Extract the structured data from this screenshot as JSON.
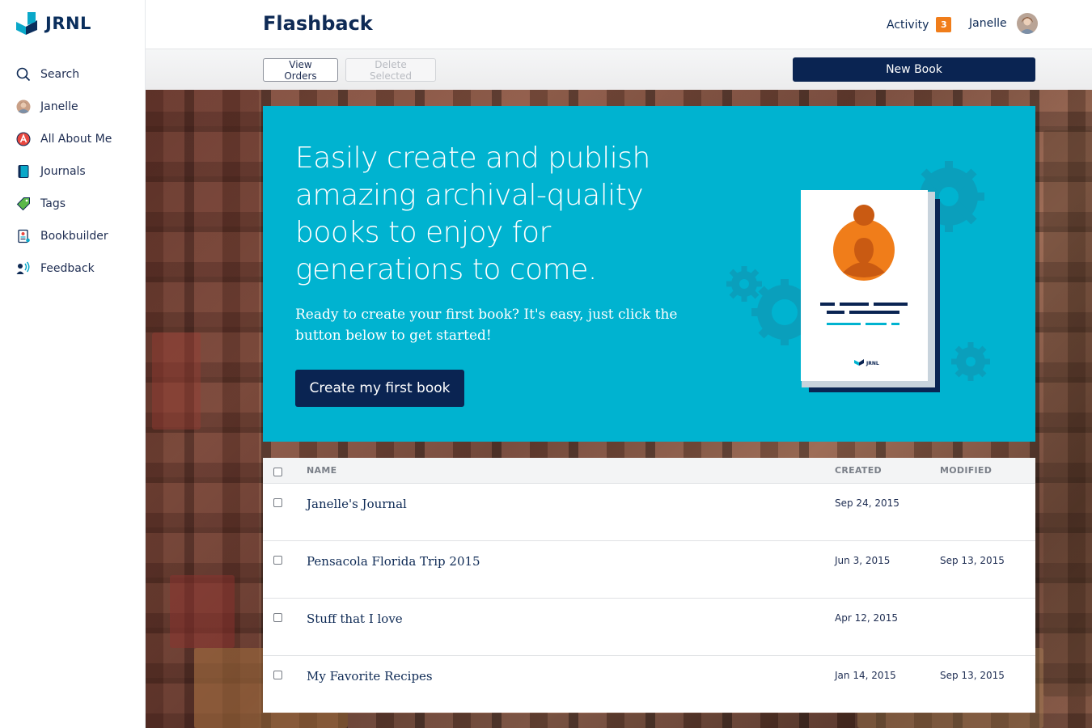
{
  "brand": {
    "logo_text": "JRNL"
  },
  "sidebar": {
    "items": [
      {
        "label": "Search",
        "icon": "search-icon"
      },
      {
        "label": "Janelle",
        "icon": "user-avatar-icon"
      },
      {
        "label": "All About Me",
        "icon": "all-about-me-icon"
      },
      {
        "label": "Journals",
        "icon": "journal-icon"
      },
      {
        "label": "Tags",
        "icon": "tag-icon"
      },
      {
        "label": "Bookbuilder",
        "icon": "bookbuilder-icon"
      },
      {
        "label": "Feedback",
        "icon": "feedback-icon"
      }
    ]
  },
  "header": {
    "title": "Flashback",
    "activity_label": "Activity",
    "activity_count": "3",
    "user_name": "Janelle"
  },
  "toolbar": {
    "view_orders_label": "View Orders",
    "delete_selected_label": "Delete Selected",
    "new_book_label": "New Book"
  },
  "promo": {
    "headline": "Easily create and publish amazing archival-quality books to enjoy for generations to come.",
    "subtext": "Ready to create your first book? It's easy, just click the button below to get started!",
    "cta_label": "Create my first book",
    "book_logo_text": "JRNL"
  },
  "table": {
    "columns": {
      "name": "NAME",
      "created": "CREATED",
      "modified": "MODIFIED"
    },
    "rows": [
      {
        "name": "Janelle's Journal",
        "created": "Sep 24, 2015",
        "modified": ""
      },
      {
        "name": "Pensacola Florida Trip 2015",
        "created": "Jun 3, 2015",
        "modified": "Sep 13, 2015"
      },
      {
        "name": "Stuff that I love",
        "created": "Apr 12, 2015",
        "modified": ""
      },
      {
        "name": "My Favorite Recipes",
        "created": "Jan 14, 2015",
        "modified": "Sep 13, 2015"
      }
    ]
  },
  "colors": {
    "navy": "#0a2452",
    "promo_teal": "#00b3d0",
    "badge_orange": "#f07d1a",
    "avatar_orange": "#f07d1a"
  }
}
